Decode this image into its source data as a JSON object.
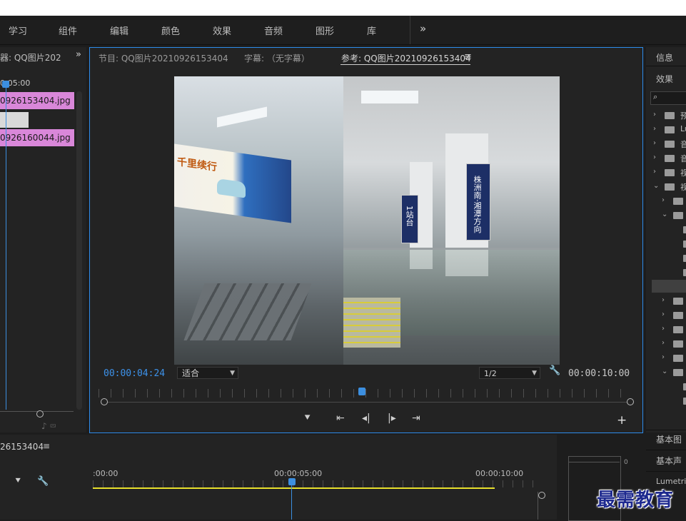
{
  "workspaces": [
    "学习",
    "组件",
    "编辑",
    "颜色",
    "效果",
    "音频",
    "图形",
    "库"
  ],
  "workspace_more": "»",
  "left_panel": {
    "tab": "器: QQ图片202",
    "more": "»",
    "time": "0:05:00",
    "clips": [
      "0926153404.jpg",
      "0926160044.jpg"
    ]
  },
  "monitor": {
    "tabs": [
      "节目: QQ图片20210926153404",
      "字幕: （无字幕）",
      "参考: QQ图片20210926153404"
    ],
    "menu_icon": "≡",
    "current_time": "00:00:04:24",
    "fit": "适合",
    "resolution": "1/2",
    "duration": "00:00:10:00",
    "frame_sign_left": "千里续行",
    "frame_sign_right_1": "1站台",
    "frame_sign_right_2": "株洲南·湘潭方向"
  },
  "right_panel": {
    "tabs": [
      "信息",
      "效果"
    ],
    "search_icon": "⌕",
    "tree_labels": [
      "预",
      "Lu",
      "音",
      "音",
      "视",
      "视"
    ],
    "bottom_tabs": [
      "基本图",
      "基本声",
      "Lumetri"
    ]
  },
  "timeline": {
    "sequence_name": "26153404",
    "menu_icon": "≡",
    "ruler_labels": [
      ":00:00",
      "00:00:05:00",
      "00:00:10:00"
    ]
  },
  "audio_meter": {
    "label": "0"
  },
  "watermark": "最需教育",
  "colors": {
    "accent": "#3c8fe0",
    "clip": "#d987d9",
    "workarea": "#e8e02c"
  }
}
